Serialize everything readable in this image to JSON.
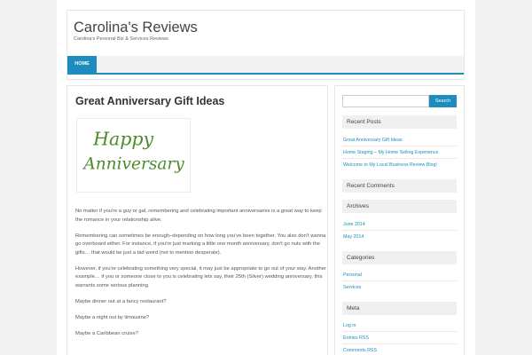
{
  "site": {
    "title": "Carolina's Reviews",
    "tagline": "Carolina's Personal Biz & Services Reviews"
  },
  "nav": {
    "items": [
      {
        "label": "HOME"
      }
    ]
  },
  "post": {
    "title": "Great Anniversary Gift Ideas",
    "image_text_line1": "Happy",
    "image_text_line2": "Anniversary",
    "paragraphs": [
      "No matter if you're a guy or gal, remembering and celebrating important anniversaries is a great way to keep the romance in your relationship alive.",
      "Remembering can sometimes be enough–depending on how long you've been together.  You also don't wanna go overboard either.  For instance, if you're just marking a little one month anniversary, don't go nuts with the gifts…  that would be just a tad weird (not to mention desperate).",
      "However, if you're celebrating something very special, it may just be appropriate to go out of your way.  Another example…  if you or someone close to you is celebrating lets say, their 25th (Silver) wedding anniversary, this warrants some serious planning.",
      "Maybe dinner out at a fancy restaurant?",
      "Maybe a night out by limousine?",
      "Maybe a Caribbean cruise?"
    ]
  },
  "sidebar": {
    "search_placeholder": "",
    "search_button": "Search",
    "recent_posts": {
      "title": "Recent Posts",
      "items": [
        "Great Anniversary Gift Ideas",
        "Home Staging – My Home Selling Experience",
        "Welcome to My Local Business Review Blog!"
      ]
    },
    "recent_comments": {
      "title": "Recent Comments"
    },
    "archives": {
      "title": "Archives",
      "items": [
        "June 2014",
        "May 2014"
      ]
    },
    "categories": {
      "title": "Categories",
      "items": [
        "Personal",
        "Services"
      ]
    },
    "meta": {
      "title": "Meta",
      "items": [
        "Log in",
        "Entries RSS",
        "Comments RSS"
      ]
    }
  },
  "colors": {
    "accent": "#1e8cbe",
    "image_text": "#4c8b2b"
  }
}
